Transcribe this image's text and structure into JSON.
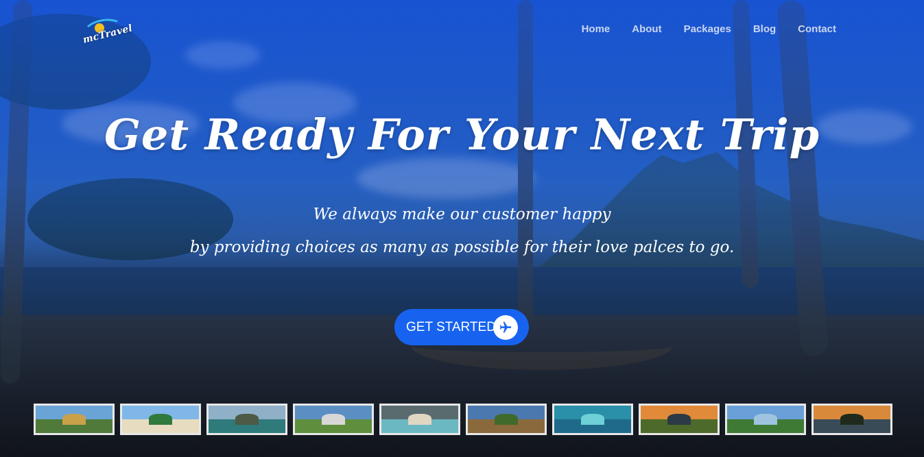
{
  "brand": {
    "logo_text": "mcTravel"
  },
  "nav": {
    "items": [
      {
        "label": "Home"
      },
      {
        "label": "About"
      },
      {
        "label": "Packages"
      },
      {
        "label": "Blog"
      },
      {
        "label": "Contact"
      }
    ]
  },
  "hero": {
    "title": "Get Ready For Your Next Trip",
    "subtitle_line1": "We always make our customer happy",
    "subtitle_line2": "by providing choices as many as possible for their love palces to go.",
    "cta_label": "GET STARTED",
    "cta_icon": "airplane-icon"
  },
  "colors": {
    "accent": "#1763f0",
    "overlay": "#1050dc",
    "nav_text": "#c9d6f2",
    "thumb_border": "#e8e8e8"
  },
  "thumbnails": [
    {
      "name": "rice-terraces",
      "sky": "#6aa3d6",
      "ground": "#4f7a3a",
      "accent": "#c9a14a"
    },
    {
      "name": "beach-umbrellas",
      "sky": "#7fb7e8",
      "ground": "#e8dcc0",
      "accent": "#2f7a3c"
    },
    {
      "name": "lagoon-cliffs",
      "sky": "#8fb0c7",
      "ground": "#2f7a7a",
      "accent": "#4d5a45"
    },
    {
      "name": "lighthouse",
      "sky": "#5b8fc4",
      "ground": "#5f8f3c",
      "accent": "#d8d8d8"
    },
    {
      "name": "island-cove",
      "sky": "#5a6b70",
      "ground": "#6cb8c2",
      "accent": "#e0d6c2"
    },
    {
      "name": "chocolate-hills",
      "sky": "#4c78b0",
      "ground": "#8a6a3c",
      "accent": "#3f6a2c"
    },
    {
      "name": "reef-aerial",
      "sky": "#2a8fa8",
      "ground": "#1f6a8a",
      "accent": "#6fd0d8"
    },
    {
      "name": "volcano-sunset",
      "sky": "#e08a3a",
      "ground": "#4d6a2a",
      "accent": "#2b3a46"
    },
    {
      "name": "hill-view",
      "sky": "#6aa0d8",
      "ground": "#3f7a34",
      "accent": "#9fc4e0"
    },
    {
      "name": "sunset-shore",
      "sky": "#d88a3a",
      "ground": "#3a4b58",
      "accent": "#1f2a1c"
    }
  ]
}
